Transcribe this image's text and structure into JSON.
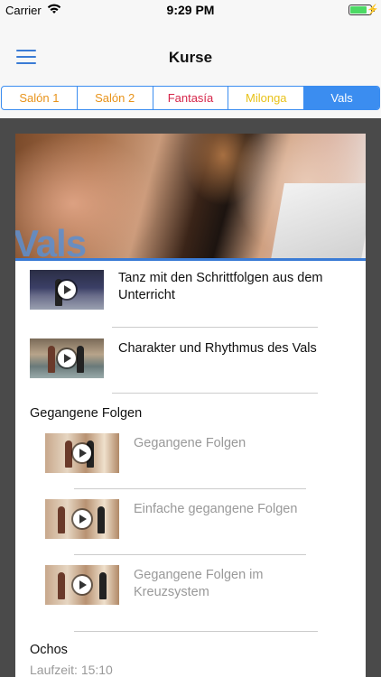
{
  "status_bar": {
    "carrier": "Carrier",
    "time": "9:29 PM",
    "battery_level": 0.9
  },
  "navbar": {
    "title": "Kurse",
    "menu_icon": "hamburger-icon"
  },
  "tabs": [
    {
      "label": "Salón 1",
      "color": "#e8931a",
      "active": false
    },
    {
      "label": "Salón 2",
      "color": "#e8931a",
      "active": false
    },
    {
      "label": "Fantasía",
      "color": "#d6264a",
      "active": false
    },
    {
      "label": "Milonga",
      "color": "#e8c21a",
      "active": false
    },
    {
      "label": "Vals",
      "color": "#ffffff",
      "active": true
    }
  ],
  "hero": {
    "label": "Vals"
  },
  "lessons": [
    {
      "title": "Tanz mit den Schrittfolgen aus dem Unterricht"
    },
    {
      "title": "Charakter und Rhythmus des Vals"
    }
  ],
  "section_gegangene": {
    "heading": "Gegangene Folgen",
    "items": [
      {
        "title": "Gegangene Folgen"
      },
      {
        "title": "Einfache gegangene Folgen"
      },
      {
        "title": "Gegangene Folgen im Kreuzsystem"
      }
    ]
  },
  "section_ochos": {
    "heading": "Ochos",
    "duration": "Laufzeit: 15:10"
  },
  "colors": {
    "accent": "#3b8df0",
    "background_dark": "#4a4a4a"
  }
}
